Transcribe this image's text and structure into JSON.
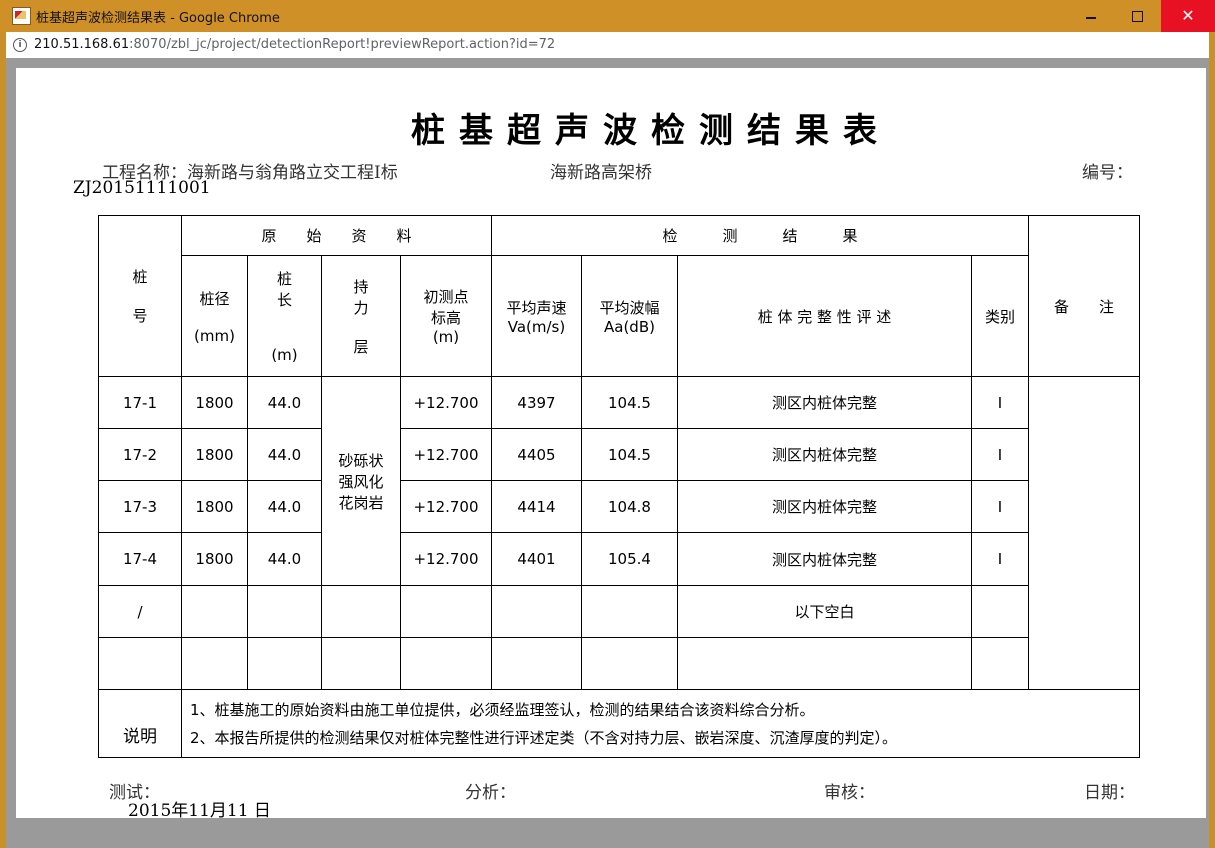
{
  "window": {
    "title": "桩基超声波检测结果表 - Google Chrome",
    "minimize_glyph": "",
    "close_glyph": "✕"
  },
  "address": {
    "host": "210.51.168.61",
    "rest": ":8070/zbl_jc/project/detectionReport!previewReport.action?id=72"
  },
  "report": {
    "title": "桩基超声波检测结果表",
    "project_label": "工程名称：海新路与翁角路立交工程Ⅰ标",
    "bridge": "海新路高架桥",
    "number_label": "编号：",
    "number": "ZJ20151111001",
    "headers": {
      "pile_no": [
        "桩",
        "号"
      ],
      "original": "原　　始　　资　　料",
      "results": "检　　　测　　　结　　　果",
      "remarks": "备　　注",
      "diameter": [
        "桩径",
        "(mm)"
      ],
      "length": [
        "桩",
        "长",
        "(m)"
      ],
      "bearing": [
        "持",
        "力",
        "层"
      ],
      "elevation": [
        "初测点",
        "标高",
        "(m)"
      ],
      "velocity": [
        "平均声速",
        "Va(m/s)"
      ],
      "amplitude": [
        "平均波幅",
        "Aa(dB)"
      ],
      "integrity": "桩 体 完 整 性 评 述",
      "category": "类别"
    },
    "bearing_layer": "砂砾状强风化花岗岩",
    "rows": [
      {
        "pile": "17-1",
        "diameter": "1800",
        "length": "44.0",
        "elevation": "+12.700",
        "velocity": "4397",
        "amplitude": "104.5",
        "integrity": "测区内桩体完整",
        "category": "Ⅰ"
      },
      {
        "pile": "17-2",
        "diameter": "1800",
        "length": "44.0",
        "elevation": "+12.700",
        "velocity": "4405",
        "amplitude": "104.5",
        "integrity": "测区内桩体完整",
        "category": "Ⅰ"
      },
      {
        "pile": "17-3",
        "diameter": "1800",
        "length": "44.0",
        "elevation": "+12.700",
        "velocity": "4414",
        "amplitude": "104.8",
        "integrity": "测区内桩体完整",
        "category": "Ⅰ"
      },
      {
        "pile": "17-4",
        "diameter": "1800",
        "length": "44.0",
        "elevation": "+12.700",
        "velocity": "4401",
        "amplitude": "105.4",
        "integrity": "测区内桩体完整",
        "category": "Ⅰ"
      }
    ],
    "blank_row": {
      "pile": "/",
      "integrity": "以下空白"
    },
    "notes_label": "说明",
    "notes": [
      "1、桩基施工的原始资料由施工单位提供，必须经监理签认，检测的结果结合该资料综合分析。",
      "2、本报告所提供的检测结果仅对桩体完整性进行评述定类（不含对持力层、嵌岩深度、沉渣厚度的判定）。"
    ],
    "footer": {
      "tester": "测试：",
      "analysis": "分析：",
      "reviewer": "审核：",
      "date_label": "日期：",
      "date": "2015年11月11 日"
    }
  }
}
